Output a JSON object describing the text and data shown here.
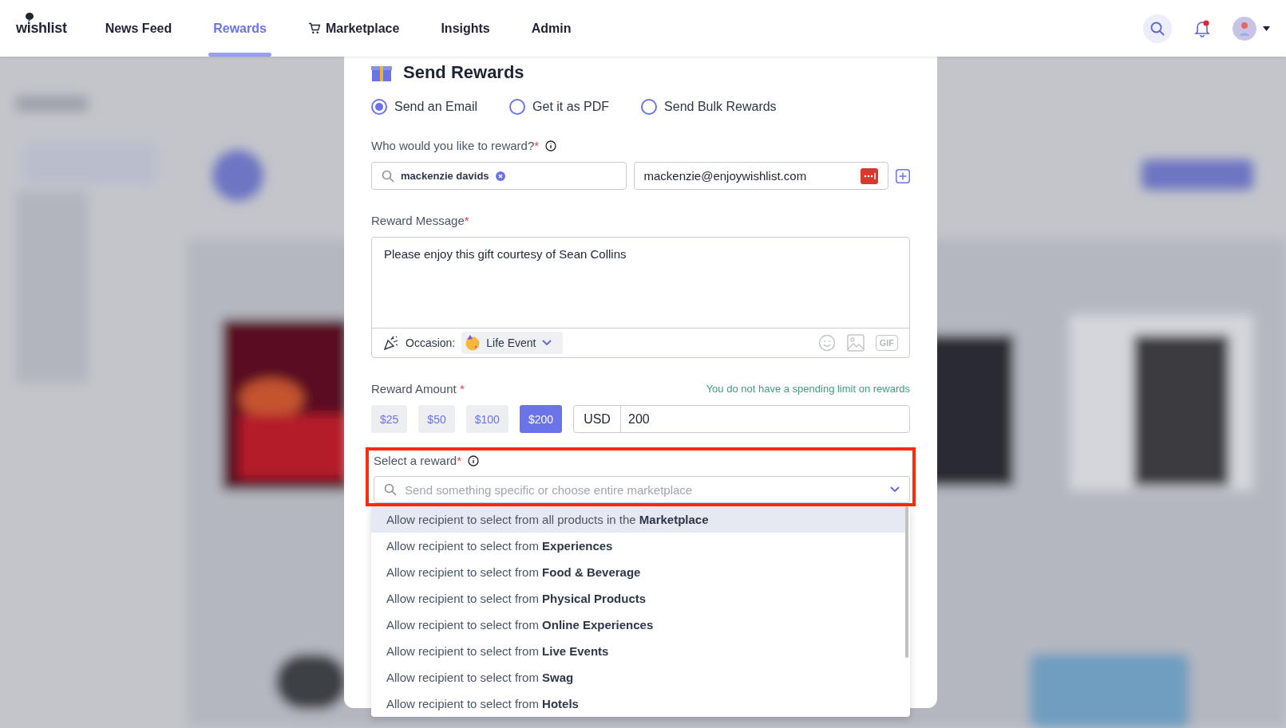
{
  "header": {
    "logo": "wishlist",
    "nav": [
      {
        "label": "News Feed",
        "selected": false
      },
      {
        "label": "Rewards",
        "selected": true
      },
      {
        "label": "Marketplace",
        "selected": false
      },
      {
        "label": "Insights",
        "selected": false
      },
      {
        "label": "Admin",
        "selected": false
      }
    ],
    "notifications": {
      "unread": true
    }
  },
  "modal": {
    "title": "Send Rewards",
    "delivery_options": [
      {
        "label": "Send an Email",
        "selected": true
      },
      {
        "label": "Get it as PDF",
        "selected": false
      },
      {
        "label": "Send Bulk Rewards",
        "selected": false
      }
    ],
    "recipient": {
      "label": "Who would you like to reward?",
      "required_mark": "*",
      "name_chip": "mackenzie davids",
      "email": "mackenzie@enjoywishlist.com"
    },
    "message": {
      "label": "Reward Message",
      "required_mark": "*",
      "value": "Please enjoy this gift courtesy of Sean Collins",
      "occasion_label": "Occasion:",
      "occasion": "Life Event",
      "gif_label": "GIF"
    },
    "amount": {
      "label": "Reward Amount",
      "required_mark": "*",
      "note": "You do not have a spending limit on rewards",
      "presets": [
        {
          "label": "$25",
          "selected": false
        },
        {
          "label": "$50",
          "selected": false
        },
        {
          "label": "$100",
          "selected": false
        },
        {
          "label": "$200",
          "selected": true
        }
      ],
      "currency": "USD",
      "value": "200"
    },
    "reward_select": {
      "label": "Select a reward",
      "required_mark": "*",
      "placeholder": "Send something specific or choose entire marketplace",
      "highlighted": true,
      "options": [
        {
          "text": "Allow recipient to select from all products in the **Marketplace**",
          "selected": true
        },
        {
          "text": "Allow recipient to select from **Experiences**",
          "selected": false
        },
        {
          "text": "Allow recipient to select from **Food & Beverage**",
          "selected": false
        },
        {
          "text": "Allow recipient to select from **Physical Products**",
          "selected": false
        },
        {
          "text": "Allow recipient to select from **Online Experiences**",
          "selected": false
        },
        {
          "text": "Allow recipient to select from **Live Events**",
          "selected": false
        },
        {
          "text": "Allow recipient to select from **Swag**",
          "selected": false
        },
        {
          "text": "Allow recipient to select from **Hotels**",
          "selected": false
        }
      ]
    }
  }
}
